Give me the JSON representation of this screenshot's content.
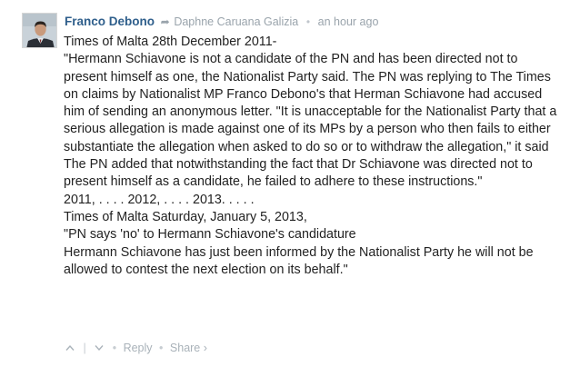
{
  "comment": {
    "author": "Franco Debono",
    "reply_to": "Daphne Caruana Galizia",
    "time": "an hour ago",
    "paragraphs": [
      "Times of Malta 28th December 2011-",
      "\"Hermann Schiavone is not a candidate of the PN and has been directed not to present himself as one, the Nationalist Party said. The PN was replying to The Times on claims by Nationalist MP Franco Debono's that Herman Schiavone had accused him of sending an anonymous letter. \"It is unacceptable for the Nationalist Party that a serious allegation is made against one of its MPs by a person who then fails to either substantiate the allegation when asked to do so or to withdraw the allegation,\" it said",
      "The PN added that notwithstanding the fact that Dr Schiavone was directed not to present himself as a candidate, he failed to adhere to these instructions.\"",
      "2011, . . . . 2012, . . . . 2013. . . . .",
      "Times of Malta Saturday, January 5, 2013,",
      "\"PN says 'no' to Hermann Schiavone's candidature",
      "Hermann Schiavone has just been informed by the Nationalist Party he will not be allowed to contest the next election on its behalf.\""
    ]
  },
  "actions": {
    "upvote_icon": "chevron-up",
    "downvote_icon": "chevron-down",
    "reply_label": "Reply",
    "share_label": "Share ›"
  },
  "colors": {
    "author": "#2e5e8b",
    "meta": "#9aa4ac",
    "body_text": "#222222"
  }
}
